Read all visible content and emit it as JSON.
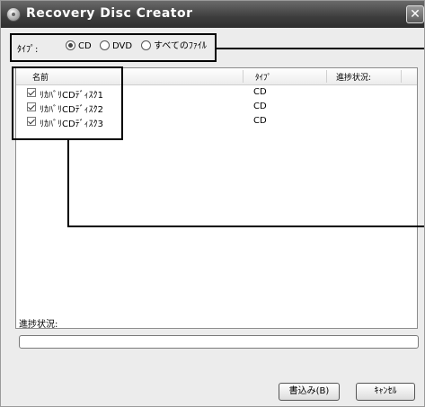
{
  "window": {
    "title": "Recovery Disc Creator",
    "close_glyph": "✕"
  },
  "type_filter": {
    "label": "ﾀｲﾌﾟ:",
    "options": [
      {
        "label": "CD",
        "selected": true
      },
      {
        "label": "DVD",
        "selected": false
      },
      {
        "label": "すべてのﾌｧｲﾙ",
        "selected": false
      }
    ]
  },
  "list": {
    "columns": [
      "名前",
      "ﾀｲﾌﾟ",
      "進捗状況:"
    ],
    "rows": [
      {
        "name": "ﾘｶﾊﾞﾘCDﾃﾞｨｽｸ1",
        "type": "CD",
        "progress": "",
        "checked": true
      },
      {
        "name": "ﾘｶﾊﾞﾘCDﾃﾞｨｽｸ2",
        "type": "CD",
        "progress": "",
        "checked": true
      },
      {
        "name": "ﾘｶﾊﾞﾘCDﾃﾞｨｽｸ3",
        "type": "CD",
        "progress": "",
        "checked": true
      }
    ]
  },
  "progress": {
    "label": "進捗状況:",
    "fraction": 0
  },
  "buttons": {
    "write": "書込み(B)",
    "cancel": "ｷｬﾝｾﾙ"
  },
  "colors": {
    "titlebar": "#3d3d3d",
    "window_bg": "#ececec",
    "highlight": "#000000"
  }
}
